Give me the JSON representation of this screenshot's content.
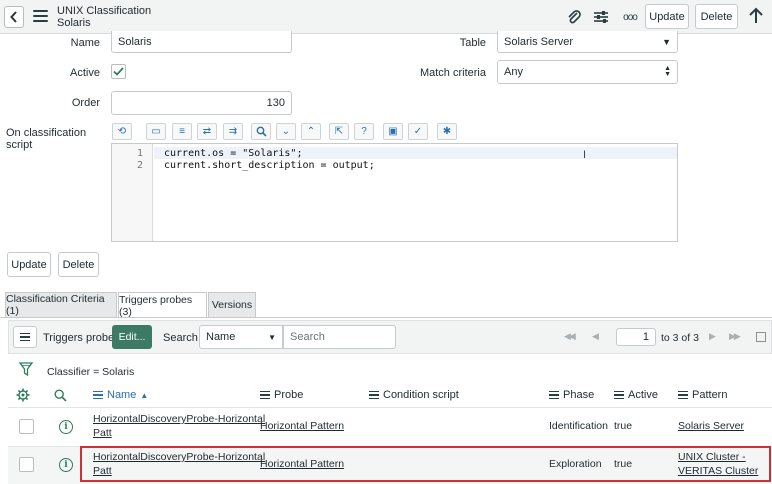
{
  "header": {
    "title": "UNIX Classification",
    "subtitle": "Solaris",
    "update_label": "Update",
    "delete_label": "Delete",
    "more_label": "ooo"
  },
  "form": {
    "name_label": "Name",
    "name_value": "Solaris",
    "table_label": "Table",
    "table_value": "Solaris Server",
    "active_label": "Active",
    "active_checked": true,
    "match_label": "Match criteria",
    "match_value": "Any",
    "order_label": "Order",
    "order_value": "130",
    "script_label": "On classification script",
    "script_lines": [
      {
        "num": "1",
        "text": "current.os = \"Solaris\";"
      },
      {
        "num": "2",
        "text": "current.short_description = output;"
      }
    ],
    "toolbar_icons": [
      "format-icon",
      "comment-icon",
      "list-icon",
      "replace-icon",
      "replace-all-icon",
      "search-icon",
      "collapse-down-icon",
      "collapse-up-icon",
      "expand-icon",
      "help-icon",
      "save-icon",
      "check-script-icon",
      "debug-icon"
    ]
  },
  "buttons": {
    "update_label": "Update",
    "delete_label": "Delete"
  },
  "tabs": [
    {
      "label": "Classification Criteria (1)",
      "active": false
    },
    {
      "label": "Triggers probes (3)",
      "active": true
    },
    {
      "label": "Versions",
      "active": false
    }
  ],
  "list": {
    "title": "Triggers probes",
    "edit_label": "Edit...",
    "search_label": "Search",
    "search_field": "Name",
    "search_placeholder": "Search",
    "page_value": "1",
    "page_total": "to 3 of 3",
    "filter_text": "Classifier = Solaris",
    "columns": [
      "Name",
      "Probe",
      "Condition script",
      "Phase",
      "Active",
      "Pattern"
    ],
    "rows": [
      {
        "name_line1": "HorizontalDiscoveryProbe-Horizontal",
        "name_line2": "Patt",
        "probe": "Horizontal Pattern",
        "condition": "",
        "phase": "Identification",
        "active": "true",
        "pattern_line1": "Solaris Server",
        "pattern_line2": ""
      },
      {
        "name_line1": "HorizontalDiscoveryProbe-Horizontal",
        "name_line2": "Patt",
        "probe": "Horizontal Pattern",
        "condition": "",
        "phase": "Exploration",
        "active": "true",
        "pattern_line1": "UNIX Cluster -",
        "pattern_line2": "VERITAS Cluster"
      }
    ]
  },
  "colors": {
    "accent_green": "#2e7d5b",
    "header_bg": "#f2f3f3",
    "highlight_border": "#d0302f"
  }
}
